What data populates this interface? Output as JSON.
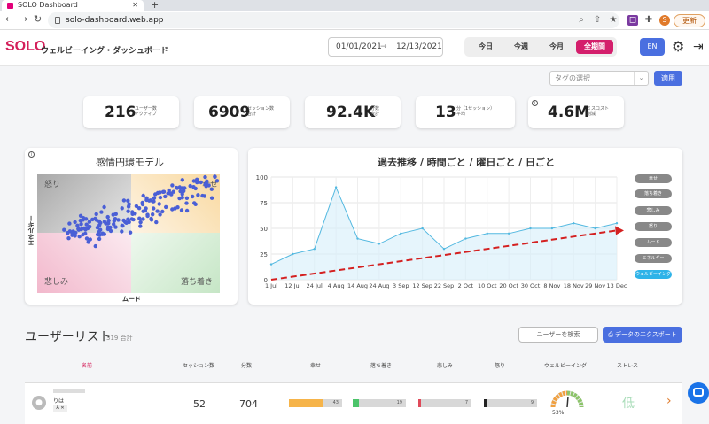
{
  "browser": {
    "tab_title": "SOLO Dashboard",
    "url": "solo-dashboard.web.app",
    "update_label": "更新",
    "profile_initial": "S"
  },
  "header": {
    "logo": "SOLO",
    "subtitle": "ウェルビーイング・ダッシュボード",
    "date_start": "01/01/2021",
    "date_arrow": "→",
    "date_end": "12/13/2021",
    "periods": [
      "今日",
      "今週",
      "今月",
      "全期間"
    ],
    "active_period": "全期間",
    "lang": "EN"
  },
  "filter": {
    "tag_placeholder": "タグの選択",
    "apply_label": "適用"
  },
  "stats": [
    {
      "value": "216",
      "label1": "ユーザー数",
      "label2": "アクティブ"
    },
    {
      "value": "6909",
      "label1": "セッション数",
      "label2": "合計"
    },
    {
      "value": "92.4K",
      "label1": "分数",
      "label2": "合計"
    },
    {
      "value": "13",
      "label1": "分（1セッション）",
      "label2": "平均"
    },
    {
      "value": "4.6M",
      "label1": "ミスコスト",
      "label2": "削減"
    }
  ],
  "emotion_card": {
    "title": "感情円環モデル",
    "y_axis": "エネルギー",
    "x_axis": "ムード",
    "quadrants": {
      "top_left": "怒り",
      "top_right": "幸せ",
      "bottom_left": "悲しみ",
      "bottom_right": "落ち着き"
    },
    "colors": {
      "top_left": "#c4c4c4",
      "top_right": "#fbe6c2",
      "bottom_left": "#f6cfdc",
      "bottom_right": "#d9eed9",
      "dots": "#4a5fd6"
    }
  },
  "trend_card": {
    "title": "過去推移 / 時間ごと / 曜日ごと / 日ごと",
    "legend": [
      "幸せ",
      "落ち着き",
      "悲しみ",
      "怒り",
      "ムード",
      "エネルギー",
      "ウェルビーイング"
    ],
    "active_legend": "ウェルビーイング"
  },
  "chart_data": {
    "type": "line",
    "x": [
      "1 Jul",
      "12 Jul",
      "24 Jul",
      "4 Aug",
      "14 Aug",
      "24 Aug",
      "3 Sep",
      "12 Sep",
      "22 Sep",
      "2 Oct",
      "10 Oct",
      "20 Oct",
      "30 Oct",
      "8 Nov",
      "18 Nov",
      "29 Nov",
      "13 Dec"
    ],
    "ylim": [
      0,
      100
    ],
    "yticks": [
      0,
      25,
      50,
      75,
      100
    ],
    "series": [
      {
        "name": "ウェルビーイング",
        "values": [
          15,
          25,
          30,
          90,
          40,
          35,
          45,
          50,
          30,
          40,
          45,
          45,
          50,
          50,
          55,
          50,
          55
        ],
        "color": "#52b8e0"
      }
    ],
    "trend": {
      "start": 0,
      "end": 48,
      "color": "#d42020"
    }
  },
  "users": {
    "title": "ユーザーリスト",
    "count": "319 合計",
    "search_label": "ユーザーを検索",
    "export_label": "データのエクスポート",
    "columns": [
      "名前",
      "セッション数",
      "分数",
      "幸せ",
      "落ち着き",
      "悲しみ",
      "怒り",
      "ウェルビーイング",
      "ストレス"
    ],
    "rows": [
      {
        "name_sub": "りは",
        "sessions": "52",
        "minutes": "704",
        "happy": 43,
        "calm": 19,
        "sad": 7,
        "angry": 9,
        "wellbeing": "53%",
        "stress": "低"
      }
    ]
  }
}
